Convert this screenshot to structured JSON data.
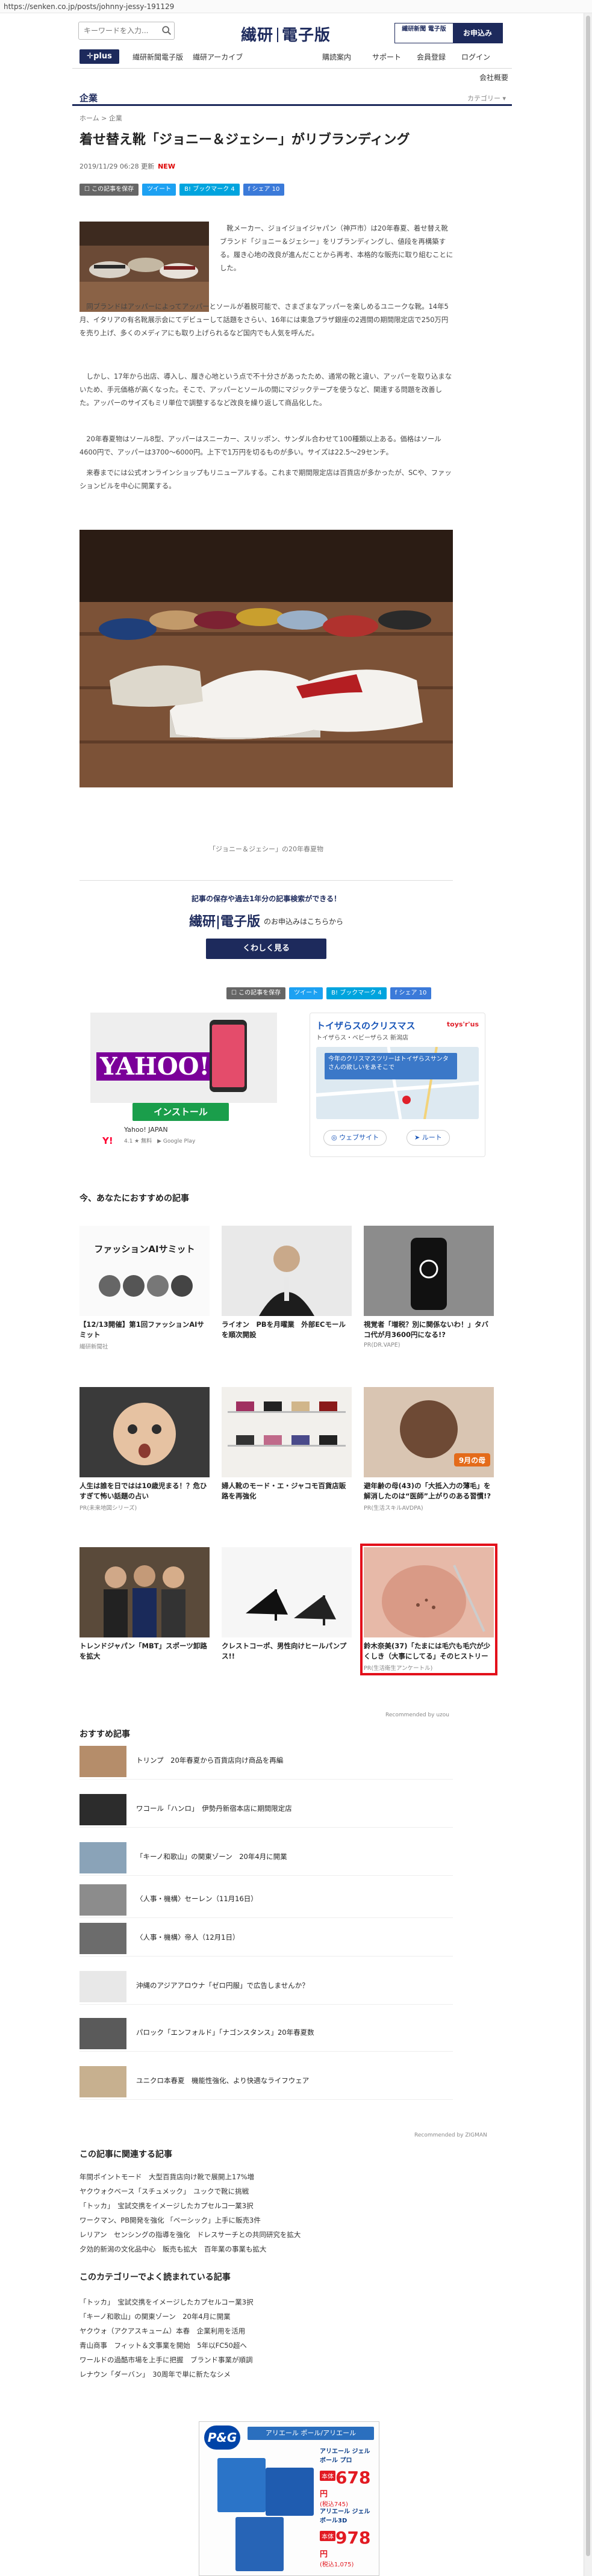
{
  "browser": {
    "url": "https://senken.co.jp/posts/johnny-jessy-191129"
  },
  "header": {
    "search_placeholder": "キーワードを入力...",
    "logo_left": "繊研",
    "logo_right": "電子版",
    "promo_left": "繊研新聞 電子版",
    "promo_right": "お申込み"
  },
  "nav": {
    "plus": "✛plus",
    "items": [
      "繊研新聞電子版",
      "繊研アーカイブ",
      "購読案内",
      "サポート",
      "会員登録",
      "ログイン"
    ],
    "sub": "会社概要"
  },
  "section": {
    "title": "企業",
    "category": "カテゴリー ▾"
  },
  "article": {
    "breadcrumb": "ホーム > 企業",
    "title": "着せ替え靴「ジョニー＆ジェシー」がリブランディング",
    "date": "2019/11/29 06:28 更新",
    "new": "NEW",
    "share": {
      "save": "☐ この記事を保存",
      "tweet": "ツイート",
      "hatena": "B! ブックマーク 4",
      "facebook": "f シェア 10"
    },
    "p1": "靴メーカー、ジョイジョイジャパン（神戸市）は20年春夏、着せ替え靴ブランド「ジョニー＆ジェシー」をリブランディングし、値段を再構築する。履き心地の改良が進んだことから再考、本格的な販売に取り組むことにした。",
    "p2": "同ブランドはアッパーによってアッパーとソールが着脱可能で、さまざまなアッパーを楽しめるユニークな靴。14年5月、イタリアの有名靴展示会にてデビューして話題をさらい、16年には東急プラザ銀座の2週間の期間限定店で250万円を売り上げ、多くのメディアにも取り上げられるなど国内でも人気を呼んだ。",
    "p3": "しかし、17年から出店、導入し、履き心地という点で不十分さがあったため、通常の靴と違い、アッパーを取り込まないため、手元価格が高くなった。そこで、アッパーとソールの間にマジックテープを使うなど、関連する問題を改善した。アッパーのサイズもミリ単位で調整するなど改良を繰り返して商品化した。",
    "p4": "20年春夏物はソール8型、アッパーはスニーカー、スリッポン、サンダル合わせて100種類以上ある。価格はソール4600円で、アッパーは3700〜6000円。上下で1万円を切るものが多い。サイズは22.5〜29センチ。",
    "p5": "来春までには公式オンラインショップもリニューアルする。これまで期間限定店は百貨店が多かったが、SCや、ファッションビルを中心に開業する。",
    "caption": "「ジョニー＆ジェシー」の20年春夏物"
  },
  "cta": {
    "line1": "記事の保存や過去1年分の記事検索ができる！",
    "logo": "繊研|電子版",
    "line2": "のお申込みはこちらから",
    "button": "くわしく見る"
  },
  "ads": {
    "yahoo": {
      "brand": "YAHOO!",
      "sub": "JAPAN",
      "install": "インストール",
      "name": "Yahoo! JAPAN",
      "rating": "4.1 ★ 無料",
      "store": "▶ Google Play"
    },
    "toyota": {
      "title": "トイザらスのクリスマス",
      "sub": "トイザらス・ベビーザらス 新潟店",
      "brand": "toys'r'us",
      "map_text": "今年のクリスマスツリーはトイザらスサンタさんの欲しいをあそこで",
      "website": "ウェブサイト",
      "route": "ルート"
    }
  },
  "recommend": {
    "heading": "今、あなたにおすすめの記事",
    "cards": [
      {
        "title": "【12/13開催】第1回ファッションAIサミット",
        "source": "繊研新聞社",
        "thumb": "ファッションAIサミット"
      },
      {
        "title": "ライオン　PBを月曜業　外部ECモールを順次開設",
        "source": "",
        "thumb": ""
      },
      {
        "title": "視覚者「増税？別に関係ないわ！」タバコ代が月3600円になる!?",
        "source": "PR(DR.VAPE)",
        "thumb": ""
      },
      {
        "title": "人生は誰を日ではは10歳児まる！？危ひすぎて怖い話題の占い",
        "source": "PR(未来地図シリーズ)",
        "thumb": ""
      },
      {
        "title": "婦人靴のモード・エ・ジャコモ百貨店販路を再強化",
        "source": "",
        "thumb": ""
      },
      {
        "title": "避年齢の母(43)の「大抵入力の薄毛」を解消したのは“医師”上がりのある習慣!?",
        "source": "PR(生活スキルAVDPA)",
        "thumb": "9月の母"
      },
      {
        "title": "トレンドジャパン「MBT」スポーツ卸路を拡大",
        "source": "",
        "thumb": ""
      },
      {
        "title": "クレストコーポ、男性向けヒールパンプス!!",
        "source": "",
        "thumb": ""
      },
      {
        "title": "鈴木奈美(37)「たまには毛穴も毛穴が少くしき（大事にしてる」そのヒストリー",
        "source": "PR(生活衛生アンケートル)",
        "thumb": ""
      }
    ],
    "powered": "Recommended by uzou"
  },
  "osusume": {
    "heading": "おすすめ記事",
    "items": [
      "トリンプ　20年春夏から百貨店向け商品を再編",
      "ワコール「ハンロ」　伊勢丹新宿本店に期間限定店",
      "「キーノ和歌山」の関東ゾーン　20年4月に開業",
      "〈人事・機構〉セーレン（11月16日）",
      "〈人事・機構〉帝人（12月1日）",
      "沖縄のアジアアロウナ「ゼロ円服」で広告しませんか？",
      "パロック「エンフォルド」「ナゴンスタンス」20年春夏数",
      "ユニクロ本春夏　機能性強化、より快適なライフウェア"
    ],
    "powered": "Recommended by ZIGMAN"
  },
  "related": {
    "heading": "この記事に関連する記事",
    "items": [
      "年間ポイントモード　大型百貨店向け靴で展開上17%増",
      "ヤクウォクベース「スチュメック」　ユックで靴に挑戦",
      "「トッカ」　宝試交携をイメージしたカプセルコ一業3択",
      "ワークマン、PB開発を強化 「ベーシック」上手に販売3件",
      "レリアン　センシングの指導を強化　ドレスサーチとの共同研究を拡大",
      "夕効的新潟の文化品中心　販売も拡大　百年業の事業も拡大"
    ]
  },
  "popular": {
    "heading": "このカテゴリーでよく読まれている記事",
    "items": [
      "「トッカ」　宝試交携をイメージしたカプセルコー業3択",
      "「キーノ和歌山」の関東ゾーン　20年4月に開業",
      "ヤクウォ（アクアスキューム）本春　企業利用を活用",
      "青山商事　フィット＆文事業を開始　5年以FC50超へ",
      "ワールドの過酷市場を上手に把握　ブランド事業が順調",
      "レナウン「ダーバン」　30周年で単に新たなシメ"
    ]
  },
  "pg_ad": {
    "brand": "P&G",
    "header": "アリエール ポール/アリエール",
    "product_1": "アリエール ジェルボール プロ",
    "price_1_badge": "本体",
    "price_1": "678",
    "price_1_tax": "(税込745)",
    "product_2": "アリエール ジェルボール3D",
    "price_2_badge": "本体",
    "price_2": "978",
    "price_2_tax": "(税込1,075)"
  },
  "colors": {
    "navy": "#1d2a5c",
    "twitter": "#1da1f2",
    "hatena": "#00a4de",
    "facebook": "#3b7ad9",
    "highlight": "#e3101b"
  }
}
